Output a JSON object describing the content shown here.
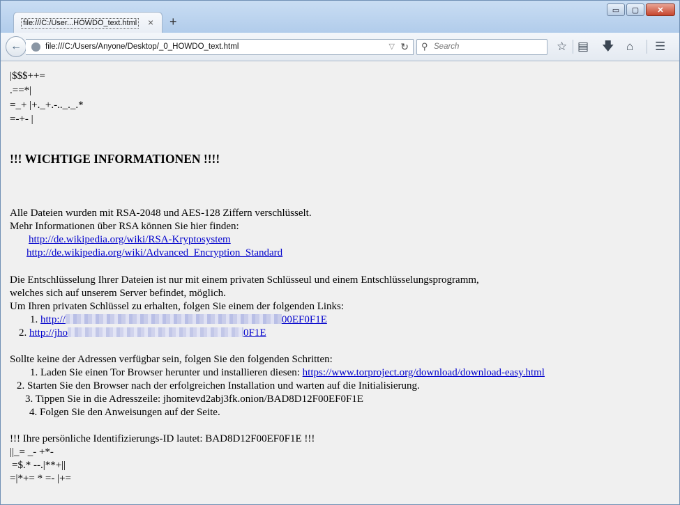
{
  "tab": {
    "title": "file:///C:/User...HOWDO_text.html",
    "close": "×",
    "new": "+"
  },
  "window_controls": {
    "minimize": "▭",
    "maximize": "▢",
    "close": "✕"
  },
  "nav": {
    "url": "file:///C:/Users/Anyone/Desktop/_0_HOWDO_text.html",
    "search_placeholder": "Search"
  },
  "page": {
    "art": [
      "|$$$++=",
      ".==*|",
      "=_+ |+._+.-.._._.*",
      "=-+- |"
    ],
    "heading": "!!! WICHTIGE INFORMATIONEN !!!!",
    "p1": "Alle Dateien wurden mit RSA-2048 und AES-128 Ziffern verschlüsselt.",
    "p2": "Mehr Informationen über RSA können Sie hier finden:",
    "link_rsa": "http://de.wikipedia.org/wiki/RSA-Kryptosystem",
    "link_aes": "http://de.wikipedia.org/wiki/Advanced_Encryption_Standard",
    "p3": "Die Entschlüsselung Ihrer Dateien ist nur mit einem privaten Schlüsseul und einem Entschlüsselungsprogramm,",
    "p4": "welches sich auf unserem Server befindet, möglich.",
    "p5": "Um Ihren privaten Schlüssel zu erhalten, folgen Sie einem der folgenden Links:",
    "links": [
      {
        "num": "1.",
        "start": "http://",
        "end": "00EF0F1E"
      },
      {
        "num": "2.",
        "start": "http://jho",
        "end": "0F1E"
      }
    ],
    "p6": "Sollte keine der Adressen verfügbar sein, folgen Sie den folgenden Schritten:",
    "step1": "1. Laden Sie einen Tor Browser herunter und installieren diesen:",
    "step1_link": "https://www.torproject.org/download/download-easy.html",
    "step2": "2. Starten Sie den Browser nach der erfolgreichen Installation und warten auf die Initialisierung.",
    "step3": "3. Tippen Sie in die Adresszeile: jhomitevd2abj3fk.onion/BAD8D12F00EF0F1E",
    "step4": "4. Folgen Sie den Anweisungen auf der Seite.",
    "id_line": "!!! Ihre persönliche Identifizierungs-ID lautet: BAD8D12F00EF0F1E !!!",
    "art2": [
      "||_= _- +*-",
      "=$.* --.|**+||",
      "=|*+= * =- |+="
    ]
  }
}
